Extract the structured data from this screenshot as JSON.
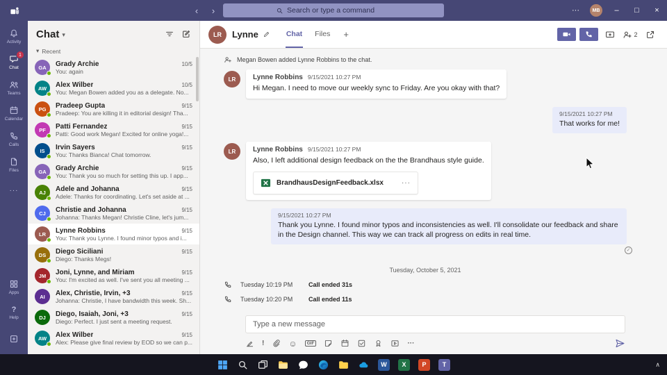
{
  "icons": {
    "back": "‹",
    "forward": "›",
    "dots": "···",
    "minimize": "–",
    "maximize": "□",
    "close": "×",
    "chevron_down": "▾",
    "chevron_up": "∧",
    "plus": "+",
    "importance": "!",
    "gif": "GIF",
    "emoji": "☺",
    "help": "?",
    "check": "✓"
  },
  "colors": {
    "accent": "#6264a7",
    "titlebar": "#464775",
    "badge": "#c4314b",
    "own_bubble": "#e8ebfa",
    "presence_available": "#6bb700"
  },
  "titlebar": {
    "search_placeholder": "Search or type a command",
    "user_initials": "MB"
  },
  "rail": {
    "items": [
      {
        "label": "Activity"
      },
      {
        "label": "Chat",
        "badge": "1"
      },
      {
        "label": "Teams"
      },
      {
        "label": "Calendar"
      },
      {
        "label": "Calls"
      },
      {
        "label": "Files"
      }
    ],
    "apps_label": "Apps",
    "help_label": "Help"
  },
  "chatlist": {
    "title": "Chat",
    "section_label": "Recent",
    "items": [
      {
        "name": "Grady Archie",
        "date": "10/5",
        "preview": "You: again",
        "initials": "GA",
        "color": "#8764b8"
      },
      {
        "name": "Alex Wilber",
        "date": "10/5",
        "preview": "You: Megan Bowen added you as a delegate. No...",
        "initials": "AW",
        "color": "#038387"
      },
      {
        "name": "Pradeep Gupta",
        "date": "9/15",
        "preview": "Pradeep: You are killing it in editorial design! Tha...",
        "initials": "PG",
        "color": "#ca5010"
      },
      {
        "name": "Patti Fernandez",
        "date": "9/15",
        "preview": "Patti: Good work Megan! Excited for online yoga!...",
        "initials": "PF",
        "color": "#c239b3"
      },
      {
        "name": "Irvin Sayers",
        "date": "9/15",
        "preview": "You: Thanks Bianca! Chat tomorrow.",
        "initials": "IS",
        "color": "#004e8c"
      },
      {
        "name": "Grady Archie",
        "date": "9/15",
        "preview": "You: Thank you so much for setting this up. I app...",
        "initials": "GA",
        "color": "#8764b8"
      },
      {
        "name": "Adele and Johanna",
        "date": "9/15",
        "preview": "Adele: Thanks for coordinating. Let's set aside at ...",
        "initials": "AJ",
        "color": "#498205"
      },
      {
        "name": "Christie and Johanna",
        "date": "9/15",
        "preview": "Johanna: Thanks Megan! Christie Cline, let's jum...",
        "initials": "CJ",
        "color": "#4f6bed"
      },
      {
        "name": "Lynne Robbins",
        "date": "9/15",
        "preview": "You: Thank you Lynne. I found minor typos and i...",
        "initials": "LR",
        "color": "#9c5b50"
      },
      {
        "name": "Diego Siciliani",
        "date": "9/15",
        "preview": "Diego: Thanks Megs!",
        "initials": "DS",
        "color": "#986f0b"
      },
      {
        "name": "Joni, Lynne, and Miriam",
        "date": "9/15",
        "preview": "You: I'm excited as well. I've sent you all meeting ...",
        "initials": "JM",
        "color": "#a4262c"
      },
      {
        "name": "Alex, Christie, Irvin, +3",
        "date": "9/15",
        "preview": "Johanna: Christie, I have bandwidth this week. Sh...",
        "initials": "AI",
        "color": "#5c2e91"
      },
      {
        "name": "Diego, Isaiah, Joni, +3",
        "date": "9/15",
        "preview": "Diego: Perfect. I just sent a meeting request.",
        "initials": "DJ",
        "color": "#0b6a0b"
      },
      {
        "name": "Alex Wilber",
        "date": "9/15",
        "preview": "Alex: Please give final review by EOD so we can p...",
        "initials": "AW",
        "color": "#038387"
      }
    ]
  },
  "conversation": {
    "title": "Lynne",
    "avatar_initials": "LR",
    "avatar_color": "#9c5b50",
    "tabs": [
      {
        "label": "Chat"
      },
      {
        "label": "Files"
      }
    ],
    "people_count": "2",
    "event_text": "Megan Bowen added Lynne Robbins to the chat.",
    "messages": [
      {
        "author": "Lynne Robbins",
        "time": "9/15/2021 10:27 PM",
        "text": "Hi Megan. I need to move our weekly sync to Friday. Are you okay with that?"
      },
      {
        "time": "9/15/2021 10:27 PM",
        "text": "That works for me!"
      },
      {
        "author": "Lynne Robbins",
        "time": "9/15/2021 10:27 PM",
        "text": "Also, I left additional design feedback on the the Brandhaus style guide.",
        "attachment_name": "BrandhausDesignFeedback.xlsx"
      },
      {
        "time": "9/15/2021 10:27 PM",
        "text": "Thank you Lynne. I found minor typos and inconsistencies as well. I'll consolidate our feedback and share in the Design channel. This way we can track all progress on edits in real time."
      }
    ],
    "date_divider": "Tuesday, October 5, 2021",
    "calls": [
      {
        "time": "Tuesday 10:19 PM",
        "status": "Call ended",
        "duration": "31s"
      },
      {
        "time": "Tuesday 10:20 PM",
        "status": "Call ended",
        "duration": "11s"
      }
    ],
    "compose_placeholder": "Type a new message"
  },
  "taskbar": {
    "app_letters": {
      "word": "W",
      "excel": "X",
      "powerpoint": "P",
      "teams": "T"
    }
  }
}
